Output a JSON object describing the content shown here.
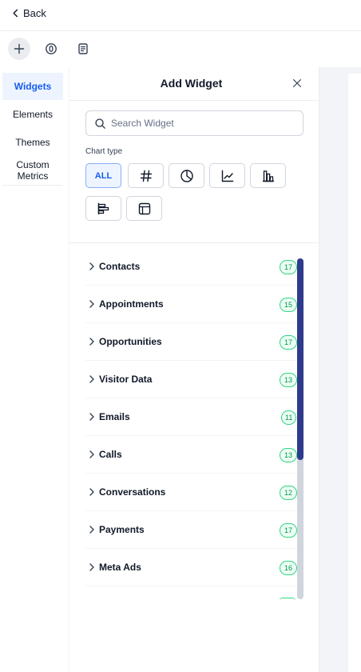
{
  "header": {
    "back_label": "Back"
  },
  "toolbar": {
    "buttons": [
      "plus-icon",
      "widget-icon",
      "notes-icon"
    ]
  },
  "sidebar": {
    "items": [
      {
        "label": "Widgets",
        "active": true
      },
      {
        "label": "Elements",
        "active": false
      },
      {
        "label": "Themes",
        "active": false
      },
      {
        "label": "Custom Metrics",
        "active": false
      }
    ]
  },
  "panel": {
    "title": "Add Widget",
    "search_placeholder": "Search Widget",
    "chart_type_label": "Chart type",
    "chart_types": [
      {
        "label": "ALL",
        "icon": "all",
        "active": true
      },
      {
        "label": "",
        "icon": "number-icon"
      },
      {
        "label": "",
        "icon": "pie-chart-icon"
      },
      {
        "label": "",
        "icon": "line-chart-icon"
      },
      {
        "label": "",
        "icon": "bar-chart-icon"
      },
      {
        "label": "",
        "icon": "horizontal-bar-chart-icon"
      },
      {
        "label": "",
        "icon": "table-icon"
      }
    ],
    "categories": [
      {
        "label": "Contacts",
        "count": "17"
      },
      {
        "label": "Appointments",
        "count": "15"
      },
      {
        "label": "Opportunities",
        "count": "17"
      },
      {
        "label": "Visitor Data",
        "count": "13"
      },
      {
        "label": "Emails",
        "count": "11"
      },
      {
        "label": "Calls",
        "count": "13"
      },
      {
        "label": "Conversations",
        "count": "12"
      },
      {
        "label": "Payments",
        "count": "17"
      },
      {
        "label": "Meta Ads",
        "count": "16"
      }
    ]
  },
  "colors": {
    "accent": "#155eef",
    "badge_green": "#32d583",
    "scroll_thumb": "#2e3a8c"
  }
}
